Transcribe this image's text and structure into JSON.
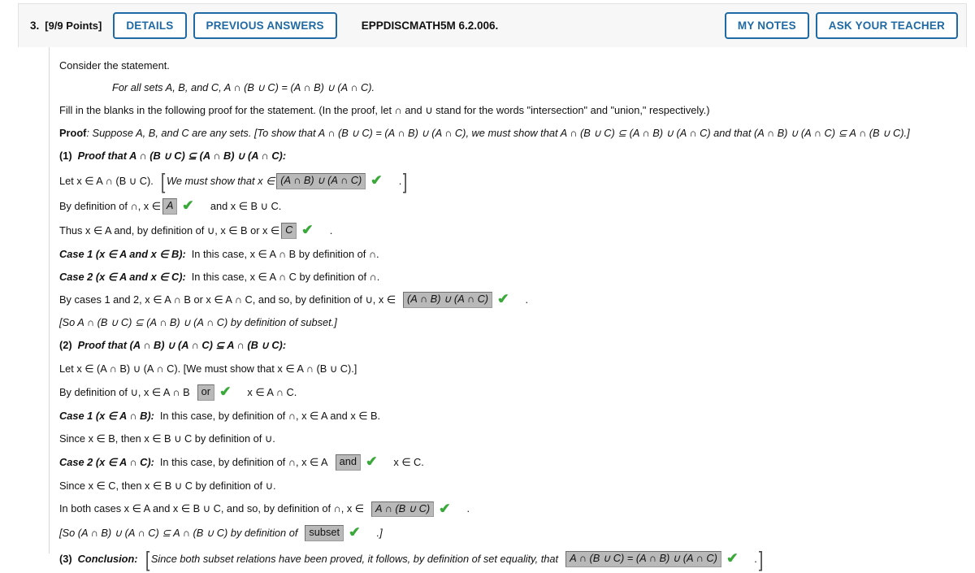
{
  "header": {
    "question_number": "3.",
    "points": "[9/9 Points]",
    "details_label": "DETAILS",
    "previous_answers_label": "PREVIOUS ANSWERS",
    "question_code": "EPPDISCMATH5M 6.2.006.",
    "my_notes_label": "MY NOTES",
    "ask_your_teacher_label": "ASK YOUR TEACHER",
    "accent_color": "#1f6aa5",
    "bar_background": "#f7f7f7"
  },
  "body": {
    "intro": "Consider the statement.",
    "statement": "For all sets A, B, and C, A ∩ (B ∪ C) = (A ∩ B) ∪ (A ∩ C).",
    "instructions": "Fill in the blanks in the following proof for the statement. (In the proof, let ∩ and ∪ stand for the words \"intersection\" and \"union,\" respectively.)",
    "proof_label": "Proof",
    "proof_line": ": Suppose A, B, and C are any sets. [To show that A ∩ (B ∪ C) = (A ∩ B) ∪ (A ∩ C), we must show that A ∩ (B ∪ C) ⊆ (A ∩ B) ∪ (A ∩ C) and that (A ∩ B) ∪ (A ∩ C) ⊆ A ∩ (B ∪ C).]",
    "part1": {
      "number": "(1)",
      "heading": "Proof that A ∩ (B ∪ C) ⊆ (A ∩ B) ∪ (A ∩ C):",
      "let_line_pre": "Let x ∈ A ∩ (B ∪ C).",
      "must_show_pre": "We must show that x ∈",
      "answer1": "(A ∩ B) ∪ (A ∩ C)",
      "must_show_post": ".",
      "def_inter_pre": "By definition of ∩, x ∈",
      "answer2": "A",
      "def_inter_post": "and x ∈ B ∪ C.",
      "thus_pre": "Thus x ∈ A and, by definition of ∪, x ∈ B or x ∈",
      "answer3": "C",
      "thus_post": ".",
      "case1_bold": "Case 1 (x ∈ A and x ∈ B):",
      "case1_rest": "In this case, x ∈ A ∩ B by definition of ∩.",
      "case2_bold": "Case 2 (x ∈ A and x ∈ C):",
      "case2_rest": "In this case, x ∈ A ∩ C by definition of ∩.",
      "bycases_pre": "By cases 1 and 2, x ∈ A ∩ B or x ∈ A ∩ C, and so, by definition of ∪, x ∈",
      "answer4": "(A ∩ B) ∪ (A ∩ C)",
      "bycases_post": ".",
      "so_line": "[So A ∩ (B ∪ C) ⊆ (A ∩ B) ∪ (A ∩ C) by definition of subset.]"
    },
    "part2": {
      "number": "(2)",
      "heading": "Proof that (A ∩ B) ∪ (A ∩ C) ⊆ A ∩ (B ∪ C):",
      "let_line": "Let x ∈ (A ∩ B) ∪ (A ∩ C). [We must show that x ∈ A ∩ (B ∪ C).]",
      "def_union_pre": "By definition of ∪, x ∈ A ∩ B",
      "answer5": "or",
      "def_union_post": "x ∈ A ∩ C.",
      "case1_bold": "Case 1 (x ∈ A ∩ B):",
      "case1_rest": "In this case, by definition of ∩, x ∈ A and x ∈ B.",
      "since1": "Since x ∈ B, then x ∈ B ∪ C by definition of ∪.",
      "case2_bold": "Case 2 (x ∈ A ∩ C):",
      "case2_mid": "In this case, by definition of ∩, x ∈ A",
      "answer6": "and",
      "case2_post": "x ∈ C.",
      "since2": "Since x ∈ C, then x ∈ B ∪ C by definition of ∪.",
      "both_pre": "In both cases x ∈ A and x ∈ B ∪ C, and so, by definition of ∩, x ∈",
      "answer7": "A ∩ (B ∪ C)",
      "both_post": ".",
      "so_pre": "[So (A ∩ B) ∪ (A ∩ C) ⊆ A ∩ (B ∪ C) by definition of",
      "answer8": "subset",
      "so_post": ".]"
    },
    "part3": {
      "number": "(3)",
      "label": "Conclusion:",
      "text_pre": "Since both subset relations have been proved, it follows, by definition of set equality, that",
      "answer9": "A ∩ (B ∪ C) = (A ∩ B) ∪ (A ∩ C)",
      "text_post": "."
    },
    "check_glyph": "✔"
  }
}
